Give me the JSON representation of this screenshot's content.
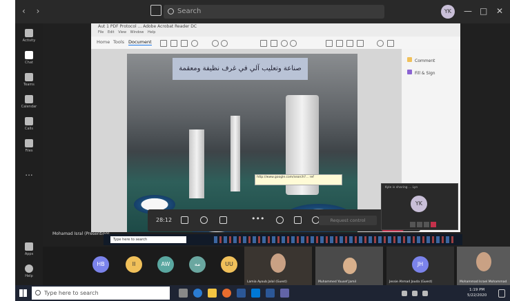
{
  "topbar": {
    "nav": "‹ ›",
    "search_placeholder": "Search",
    "avatar": "YK",
    "win_min": "—",
    "win_max": "□",
    "win_close": "✕"
  },
  "rail": [
    {
      "label": "Activity",
      "icon": "bell-icon"
    },
    {
      "label": "Chat",
      "icon": "chat-icon"
    },
    {
      "label": "Teams",
      "icon": "teams-icon"
    },
    {
      "label": "Calendar",
      "icon": "calendar-icon"
    },
    {
      "label": "Calls",
      "icon": "phone-icon"
    },
    {
      "label": "Files",
      "icon": "file-icon"
    },
    {
      "label": "...",
      "icon": "more-icon"
    },
    {
      "label": "Apps",
      "icon": "apps-icon"
    },
    {
      "label": "Help",
      "icon": "help-icon"
    }
  ],
  "pdf": {
    "title": "Aut 1 PDF Protocol ... Adobe Acrobat Reader DC",
    "menu": "File Edit View Window Help",
    "tabs": [
      "Home",
      "Tools",
      "Document"
    ],
    "banner": "صناعة وتعليب آلي في غرف نظيفة ومعقمة",
    "tooltip": "http://www.google.com/search?... ref",
    "right_items": [
      "Comment",
      "Fill & Sign"
    ]
  },
  "call": {
    "timer": "28:12",
    "request": "Request control",
    "presenter": "Mohamad Isral (Presenting)"
  },
  "mini": {
    "caption": "Kyle is sharing ... Lyn",
    "avatar": "YK"
  },
  "inner_taskbar": {
    "search": "Type here to search"
  },
  "participants": {
    "avatars": [
      {
        "initials": "HB",
        "color": "#7b83eb"
      },
      {
        "initials": "II",
        "color": "#f0c05a"
      },
      {
        "initials": "AW",
        "color": "#5aa7a0"
      },
      {
        "initials": "مه",
        "color": "#6aa7a0"
      },
      {
        "initials": "UU",
        "color": "#f0c05a"
      }
    ],
    "tiles": [
      {
        "name": "Lamia Ayoub Jalal (Guest)"
      },
      {
        "name": "Muhammed Yousef Jamil"
      },
      {
        "name": "Jessie Ahmad Jouda (Guest)"
      },
      {
        "name": "Mohammad Israel Mohammad"
      }
    ],
    "jh": "JH"
  },
  "windows_taskbar": {
    "search": "Type here to search",
    "time": "1:19 PM",
    "date": "5/22/2020"
  }
}
